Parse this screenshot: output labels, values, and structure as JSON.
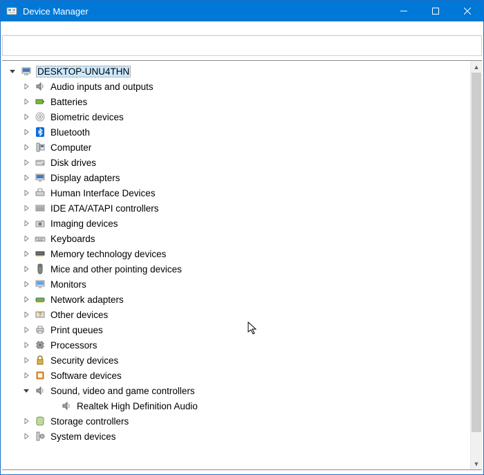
{
  "window": {
    "title": "Device Manager"
  },
  "root": {
    "name": "DESKTOP-UNU4THN",
    "expanded": true,
    "selected": true,
    "icon": "computer-icon"
  },
  "categories": [
    {
      "label": "Audio inputs and outputs",
      "icon": "speaker-icon",
      "expanded": false
    },
    {
      "label": "Batteries",
      "icon": "battery-icon",
      "expanded": false
    },
    {
      "label": "Biometric devices",
      "icon": "fingerprint-icon",
      "expanded": false
    },
    {
      "label": "Bluetooth",
      "icon": "bluetooth-icon",
      "expanded": false
    },
    {
      "label": "Computer",
      "icon": "pc-icon",
      "expanded": false
    },
    {
      "label": "Disk drives",
      "icon": "disk-icon",
      "expanded": false
    },
    {
      "label": "Display adapters",
      "icon": "display-icon",
      "expanded": false
    },
    {
      "label": "Human Interface Devices",
      "icon": "hid-icon",
      "expanded": false
    },
    {
      "label": "IDE ATA/ATAPI controllers",
      "icon": "ide-icon",
      "expanded": false
    },
    {
      "label": "Imaging devices",
      "icon": "camera-icon",
      "expanded": false
    },
    {
      "label": "Keyboards",
      "icon": "keyboard-icon",
      "expanded": false
    },
    {
      "label": "Memory technology devices",
      "icon": "memory-icon",
      "expanded": false
    },
    {
      "label": "Mice and other pointing devices",
      "icon": "mouse-icon",
      "expanded": false
    },
    {
      "label": "Monitors",
      "icon": "monitor-icon",
      "expanded": false
    },
    {
      "label": "Network adapters",
      "icon": "network-icon",
      "expanded": false
    },
    {
      "label": "Other devices",
      "icon": "other-icon",
      "expanded": false
    },
    {
      "label": "Print queues",
      "icon": "printer-icon",
      "expanded": false
    },
    {
      "label": "Processors",
      "icon": "cpu-icon",
      "expanded": false
    },
    {
      "label": "Security devices",
      "icon": "security-icon",
      "expanded": false
    },
    {
      "label": "Software devices",
      "icon": "software-icon",
      "expanded": false
    },
    {
      "label": "Sound, video and game controllers",
      "icon": "speaker-icon",
      "expanded": true,
      "children": [
        {
          "label": "Realtek High Definition Audio",
          "icon": "speaker-icon"
        }
      ]
    },
    {
      "label": "Storage controllers",
      "icon": "storage-icon",
      "expanded": false
    },
    {
      "label": "System devices",
      "icon": "system-icon",
      "expanded": false
    }
  ]
}
